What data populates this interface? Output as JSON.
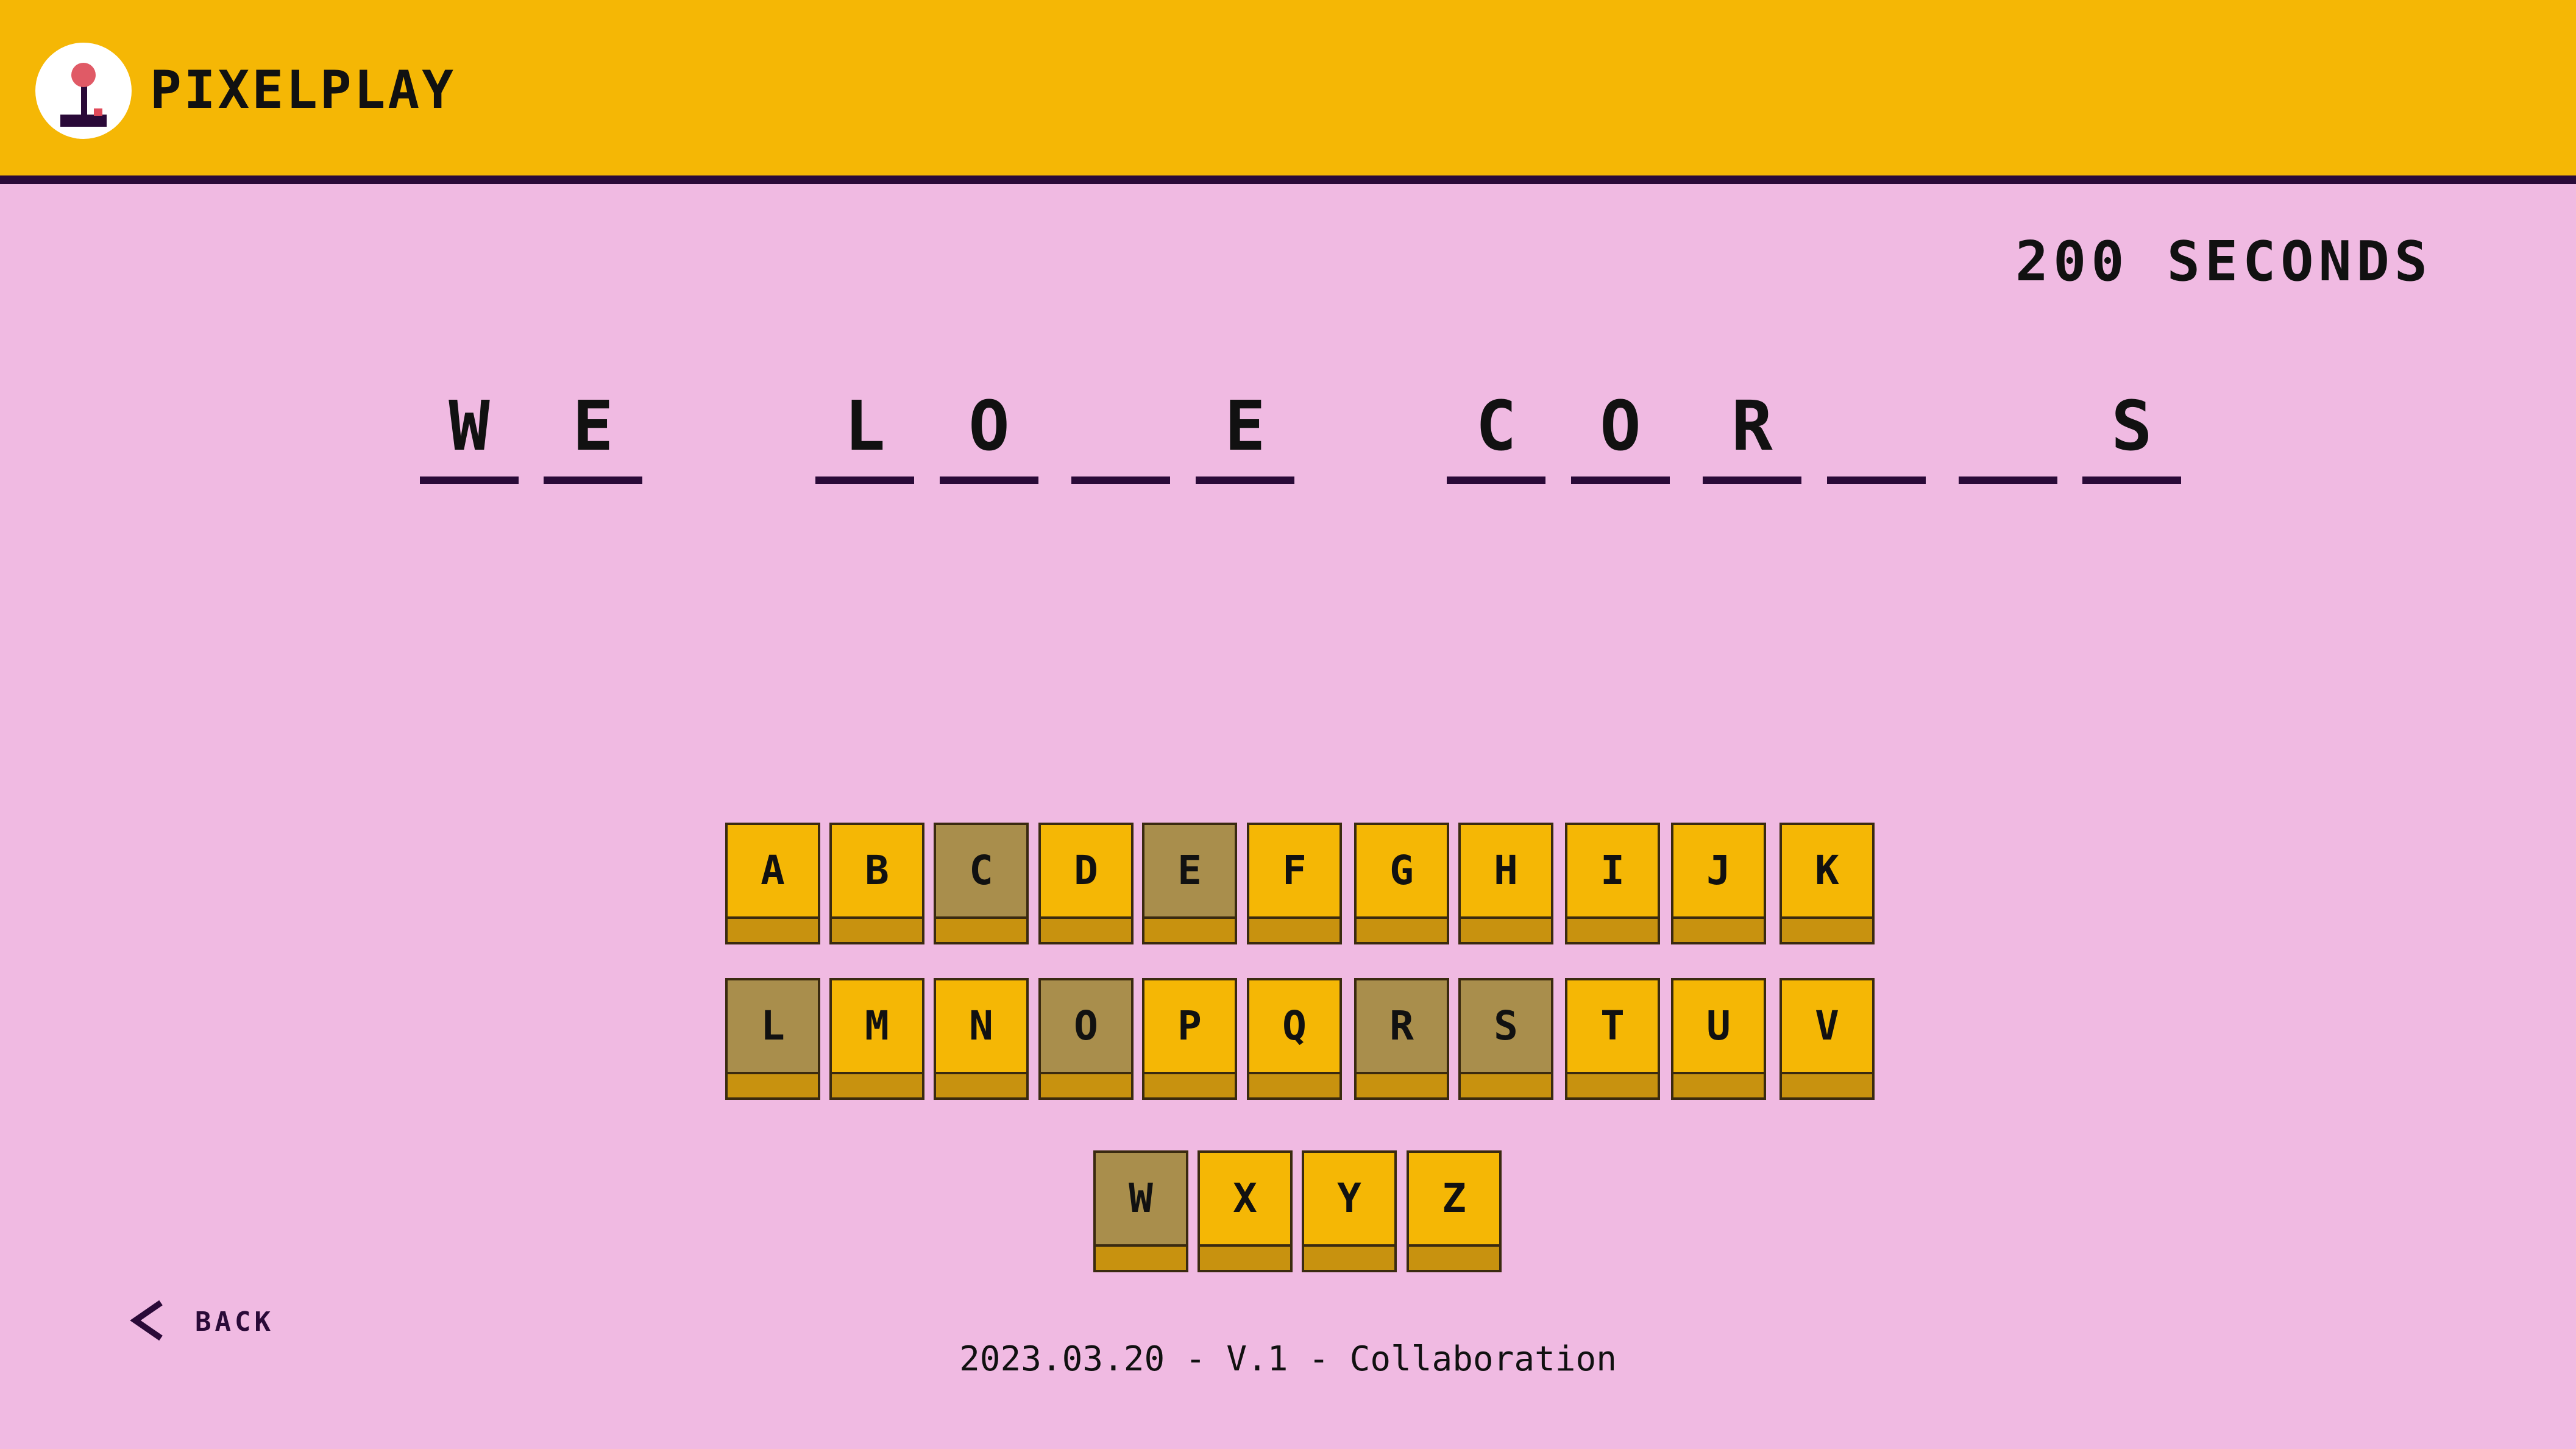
{
  "header": {
    "brand": "PIXELPLAY",
    "logo_icon": "joystick-icon",
    "colors": {
      "bar": "#f5b705",
      "underline": "#2a0a38"
    }
  },
  "timer": {
    "text": "200 SECONDS"
  },
  "puzzle": {
    "slots": [
      "W",
      "E",
      "",
      "L",
      "O",
      "",
      "E",
      "",
      "C",
      "O",
      "R",
      "",
      "",
      "S"
    ],
    "words": [
      [
        "W",
        "E"
      ],
      [
        "L",
        "O",
        "",
        "E"
      ],
      [
        "C",
        "O",
        "R",
        "",
        "",
        "S"
      ]
    ]
  },
  "keyboard": {
    "rows": [
      [
        {
          "letter": "A",
          "used": false
        },
        {
          "letter": "B",
          "used": false
        },
        {
          "letter": "C",
          "used": true
        },
        {
          "letter": "D",
          "used": false
        },
        {
          "letter": "E",
          "used": true
        },
        {
          "letter": "F",
          "used": false
        },
        {
          "letter": "G",
          "used": false
        },
        {
          "letter": "H",
          "used": false
        },
        {
          "letter": "I",
          "used": false
        },
        {
          "letter": "J",
          "used": false
        },
        {
          "letter": "K",
          "used": false
        }
      ],
      [
        {
          "letter": "L",
          "used": true
        },
        {
          "letter": "M",
          "used": false
        },
        {
          "letter": "N",
          "used": false
        },
        {
          "letter": "O",
          "used": true
        },
        {
          "letter": "P",
          "used": false
        },
        {
          "letter": "Q",
          "used": false
        },
        {
          "letter": "R",
          "used": true
        },
        {
          "letter": "S",
          "used": true
        },
        {
          "letter": "T",
          "used": false
        },
        {
          "letter": "U",
          "used": false
        },
        {
          "letter": "V",
          "used": false
        }
      ],
      [
        {
          "letter": "W",
          "used": true
        },
        {
          "letter": "X",
          "used": false
        },
        {
          "letter": "Y",
          "used": false
        },
        {
          "letter": "Z",
          "used": false
        }
      ]
    ],
    "colors": {
      "key": "#f5b705",
      "used": "#a98e4c",
      "base": "#c8920f"
    }
  },
  "nav": {
    "back_label": "BACK",
    "back_icon": "chevron-left-icon"
  },
  "footer": {
    "text": "2023.03.20 - V.1 - Collaboration"
  }
}
